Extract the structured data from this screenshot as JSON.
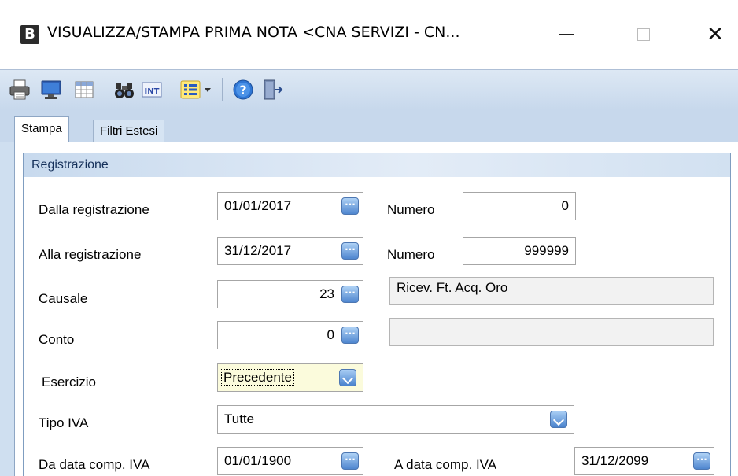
{
  "window": {
    "app_icon_letter": "B",
    "title": "VISUALIZZA/STAMPA PRIMA NOTA <CNA SERVIZI - CN...",
    "minimize": "—",
    "maximize": "",
    "close": "✕"
  },
  "toolbar": {
    "items": [
      "printer-icon",
      "monitor-icon",
      "spreadsheet-icon",
      "binoculars-icon",
      "int-icon",
      "list-options-icon",
      "help-icon",
      "exit-door-icon"
    ],
    "int_label": "INT"
  },
  "tabs": [
    {
      "label": "Stampa",
      "active": true
    },
    {
      "label": "Filtri Estesi",
      "active": false
    }
  ],
  "group": {
    "title": "Registrazione"
  },
  "form": {
    "dalla_registrazione": {
      "label": "Dalla registrazione",
      "value": "01/01/2017"
    },
    "numero_da": {
      "label": "Numero",
      "value": "0"
    },
    "alla_registrazione": {
      "label": "Alla registrazione",
      "value": "31/12/2017"
    },
    "numero_a": {
      "label": "Numero",
      "value": "999999"
    },
    "causale": {
      "label": "Causale",
      "value": "23",
      "description": "Ricev. Ft. Acq. Oro"
    },
    "conto": {
      "label": "Conto",
      "value": "0",
      "description": ""
    },
    "esercizio": {
      "label": "Esercizio",
      "value": "Precedente"
    },
    "tipo_iva": {
      "label": "Tipo IVA",
      "value": "Tutte"
    },
    "da_data_comp_iva": {
      "label": "Da data comp. IVA",
      "value": "01/01/1900"
    },
    "a_data_comp_iva": {
      "label": "A data comp. IVA",
      "value": "31/12/2099"
    },
    "ellipsis": "···"
  },
  "colors": {
    "toolbar_bg": "#c7d8ec",
    "accent_button": "#4f86cf",
    "selected_combo_bg": "#fbfbdc"
  }
}
